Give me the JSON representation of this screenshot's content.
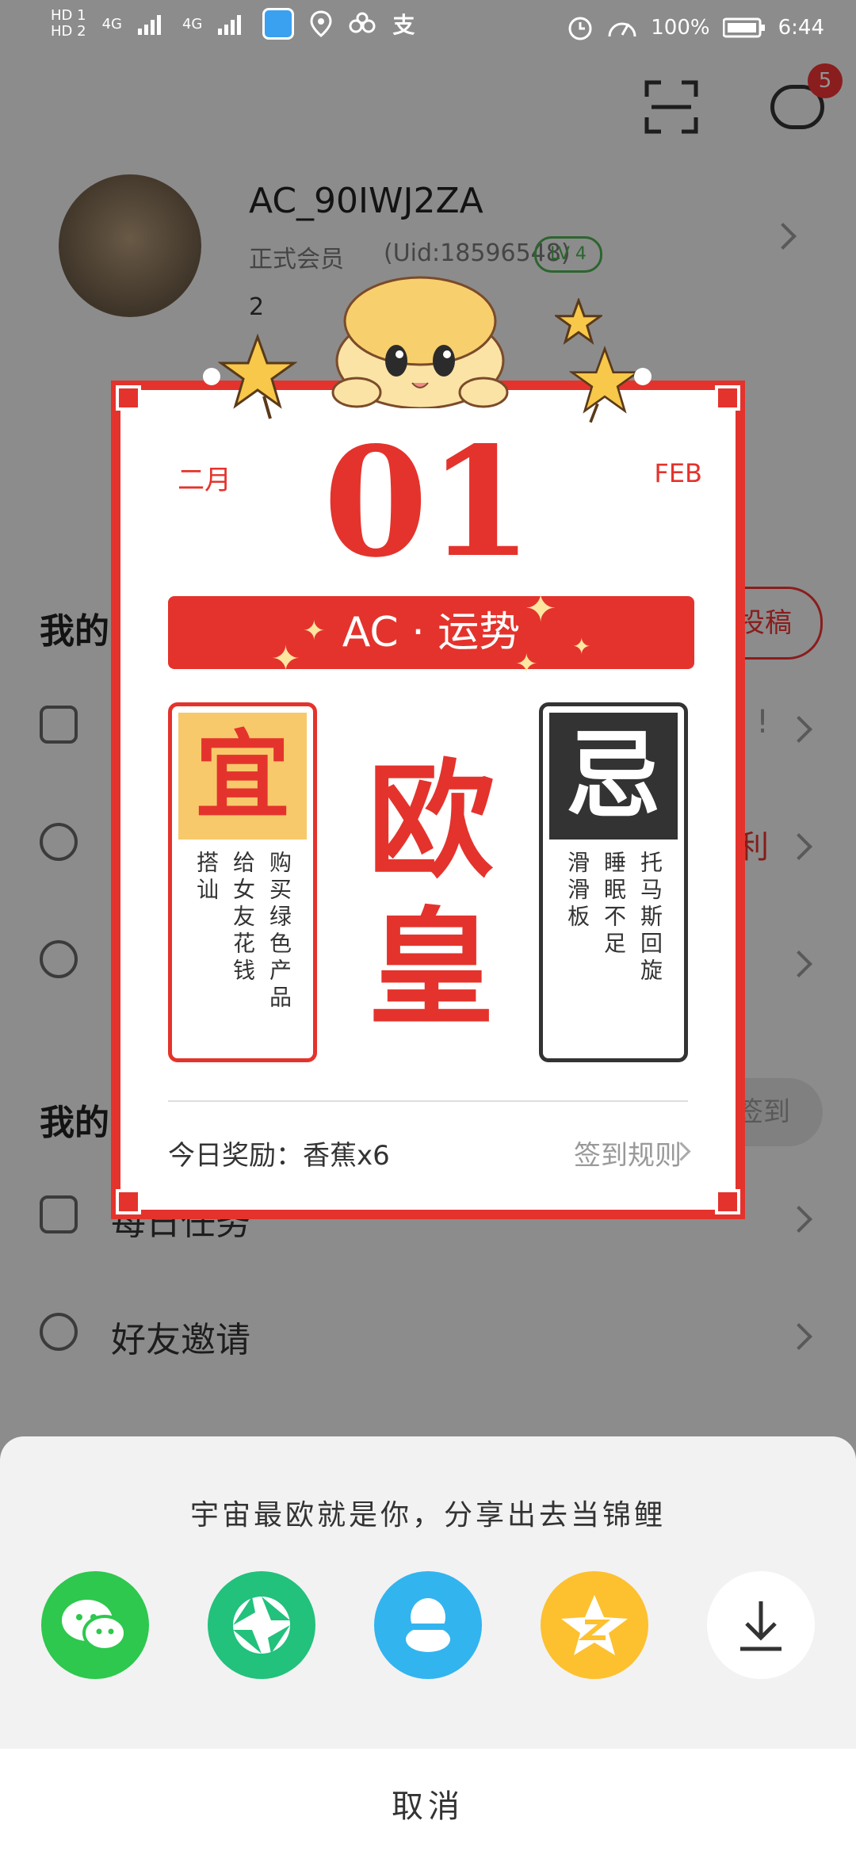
{
  "status_bar": {
    "left_indicators": [
      "HD 1",
      "HD 2",
      "4G",
      "4G"
    ],
    "battery_percent": "100%",
    "time": "6:44"
  },
  "header": {
    "message_badge": "5"
  },
  "profile": {
    "username": "AC_90IWJ2ZA",
    "member": "正式会员",
    "uid": "(Uid:18596548)",
    "level": "LV 4",
    "banana_count": "2"
  },
  "sections": {
    "my_content_title": "我的",
    "submit_label": "投稿",
    "rows_a": [
      {
        "label": "",
        "extra": "!"
      },
      {
        "label": "",
        "extra": "福利"
      },
      {
        "label": "",
        "extra": ""
      }
    ],
    "my_tasks_title": "我的",
    "checkin_label": "签到",
    "rows_b": [
      {
        "label": "每日任务"
      },
      {
        "label": "好友邀请"
      }
    ]
  },
  "calendar": {
    "month_cn": "二月",
    "month_en": "FEB",
    "day": "01",
    "banner": "AC · 运势",
    "yi": {
      "head": "宜",
      "cols": [
        "购买绿色产品",
        "给女友花钱",
        "搭讪"
      ]
    },
    "ji": {
      "head": "忌",
      "cols": [
        "托马斯回旋",
        "睡眠不足",
        "滑滑板"
      ]
    },
    "fortune": [
      "欧",
      "皇"
    ],
    "reward": "今日奖励：香蕉x6",
    "rules": "签到规则"
  },
  "share": {
    "title": "宇宙最欧就是你，分享出去当锦鲤",
    "buttons": [
      {
        "name": "wechat",
        "color": "#2dc84d"
      },
      {
        "name": "moments",
        "color": "#22c17c"
      },
      {
        "name": "qq",
        "color": "#32b4ef"
      },
      {
        "name": "qzone",
        "color": "#fdc02f"
      },
      {
        "name": "download",
        "color": "#ffffff"
      }
    ],
    "cancel": "取消"
  },
  "colors": {
    "accent_red": "#e4332c",
    "dim": "rgba(0,0,0,0.42)"
  }
}
